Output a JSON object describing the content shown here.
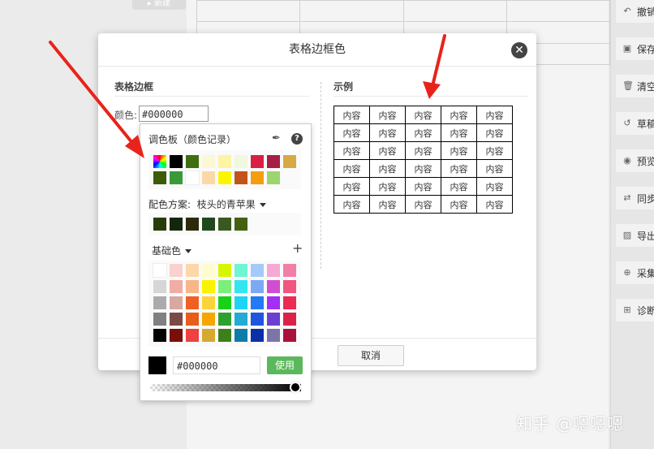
{
  "dialog": {
    "title": "表格边框色",
    "border_section": "表格边框",
    "color_label": "颜色:",
    "color_value": "#000000",
    "sample_section": "示例",
    "cell_text": "内容",
    "cancel_label": "取消"
  },
  "picker": {
    "palette_title": "调色板（颜色记录）",
    "help": "?",
    "scheme_label": "配色方案:",
    "scheme_value": "枝头的青苹果",
    "basic_label": "基础色",
    "plus": "+",
    "hex_value": "#000000",
    "use_label": "使用",
    "history_colors": [
      [
        "rainbow",
        "#000000",
        "#3f6d0f",
        "#fbf8d6",
        "#fdf4a4",
        "#f0f8de",
        "#d91f43",
        "#a71f44",
        "#d6a945"
      ],
      [
        "#3c5c09",
        "#3a9a3a",
        "#ffffff",
        "#fcd8a8",
        "#fcf500",
        "#c2541b",
        "#f59d11",
        "#9bd56e"
      ]
    ],
    "scheme_colors": [
      "#263d0b",
      "#15270a",
      "#2c2a0b",
      "#20471e",
      "#3a591e",
      "#436111"
    ],
    "basic_colors": [
      [
        "#ffffff",
        "#f9d1cf",
        "#fcd8a8",
        "#fefccf",
        "#d6f500",
        "#6ef5d3",
        "#a5c9f8",
        "#f5a9d3",
        "#f07fa8"
      ],
      [
        "#d6d6d6",
        "#f2aca4",
        "#f8b688",
        "#fcf200",
        "#7af07a",
        "#31e6f0",
        "#7ba9f5",
        "#d04ed0",
        "#f0567e"
      ],
      [
        "#ababab",
        "#d9a8a0",
        "#f06025",
        "#fad43a",
        "#19d119",
        "#1ed4f5",
        "#2479f5",
        "#a32ff5",
        "#ec2a52"
      ],
      [
        "#808080",
        "#7c4a45",
        "#e85d1a",
        "#f7a500",
        "#2ea02e",
        "#23aad7",
        "#1f55df",
        "#6b3fd0",
        "#da2248"
      ],
      [
        "#000000",
        "#7a0f0a",
        "#f04040",
        "#d8a830",
        "#3d7f1a",
        "#0f7ca8",
        "#0a30a8",
        "#7d75a8",
        "#a8123d"
      ]
    ]
  },
  "sidebar": {
    "items": [
      {
        "icon": "undo-icon",
        "label": "撤销"
      },
      {
        "icon": "save-icon",
        "label": "保存"
      },
      {
        "icon": "trash-icon",
        "label": "清空"
      },
      {
        "icon": "history-icon",
        "label": "草稿"
      },
      {
        "icon": "eye-icon",
        "label": "预览"
      },
      {
        "icon": "sync-icon",
        "label": "同步"
      },
      {
        "icon": "image-export-icon",
        "label": "导出"
      },
      {
        "icon": "search-plus-icon",
        "label": "采集"
      },
      {
        "icon": "plus-box-icon",
        "label": "诊断"
      }
    ]
  },
  "watermark": "知乎 @嗯嗯嗯"
}
